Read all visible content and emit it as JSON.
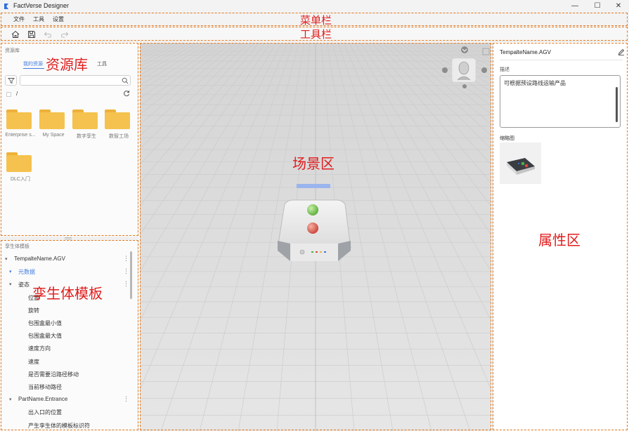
{
  "window": {
    "title": "FactVerse Designer",
    "controls": {
      "minimize": "—",
      "maximize": "☐",
      "close": "✕"
    }
  },
  "menubar": {
    "items": [
      "文件",
      "工具",
      "设置"
    ]
  },
  "toolbar": {
    "icons": [
      "home-icon",
      "save-icon",
      "undo-icon",
      "redo-icon"
    ]
  },
  "assets_panel": {
    "title": "资源库",
    "tabs": [
      "我的资源",
      "工具"
    ],
    "active_tab": "我的资源",
    "search": {
      "value": "",
      "placeholder": ""
    },
    "path": "/",
    "folders": [
      "Enterprise s...",
      "My Space",
      "数字孪生",
      "数智工场",
      "DLC入门"
    ]
  },
  "template_panel": {
    "title": "孪生体模板",
    "rows": [
      {
        "label": "TempalteName.AGV",
        "level": 0,
        "caret": "▾",
        "kebab": true,
        "color": "normal"
      },
      {
        "label": "元数据",
        "level": 1,
        "caret": "▾",
        "kebab": true,
        "color": "blue"
      },
      {
        "label": "姿态",
        "level": 1,
        "caret": "▾",
        "kebab": true,
        "color": "normal"
      },
      {
        "label": "位置",
        "level": 2,
        "caret": "",
        "kebab": false,
        "color": "normal"
      },
      {
        "label": "旋转",
        "level": 2,
        "caret": "",
        "kebab": false,
        "color": "normal"
      },
      {
        "label": "包围盒最小值",
        "level": 2,
        "caret": "",
        "kebab": false,
        "color": "normal"
      },
      {
        "label": "包围盒最大值",
        "level": 2,
        "caret": "",
        "kebab": false,
        "color": "normal"
      },
      {
        "label": "速度方向",
        "level": 2,
        "caret": "",
        "kebab": false,
        "color": "normal"
      },
      {
        "label": "速度",
        "level": 2,
        "caret": "",
        "kebab": false,
        "color": "normal"
      },
      {
        "label": "是否需要沿路径移动",
        "level": 2,
        "caret": "",
        "kebab": false,
        "color": "normal"
      },
      {
        "label": "当前移动路径",
        "level": 2,
        "caret": "",
        "kebab": false,
        "color": "normal"
      },
      {
        "label": "PartName.Entrance",
        "level": 1,
        "caret": "▾",
        "kebab": true,
        "color": "normal"
      },
      {
        "label": "出入口的位置",
        "level": 2,
        "caret": "",
        "kebab": false,
        "color": "normal"
      },
      {
        "label": "产生孪生体的模板标识符",
        "level": 2,
        "caret": "",
        "kebab": false,
        "color": "normal"
      }
    ]
  },
  "properties_panel": {
    "name": "TempalteName.AGV",
    "description_label": "描述",
    "description": "可根据预设路线运输产品",
    "thumbnail_label": "缩略图"
  },
  "annotations": {
    "menubar": "菜单栏",
    "toolbar": "工具栏",
    "assets": "资源库",
    "template": "孪生体模板",
    "scene": "场景区",
    "properties": "属性区"
  },
  "colors": {
    "accent": "#3f7be0",
    "annotation": "#e11d1d",
    "outline": "#e0781f",
    "folder": "#f5c24f"
  }
}
